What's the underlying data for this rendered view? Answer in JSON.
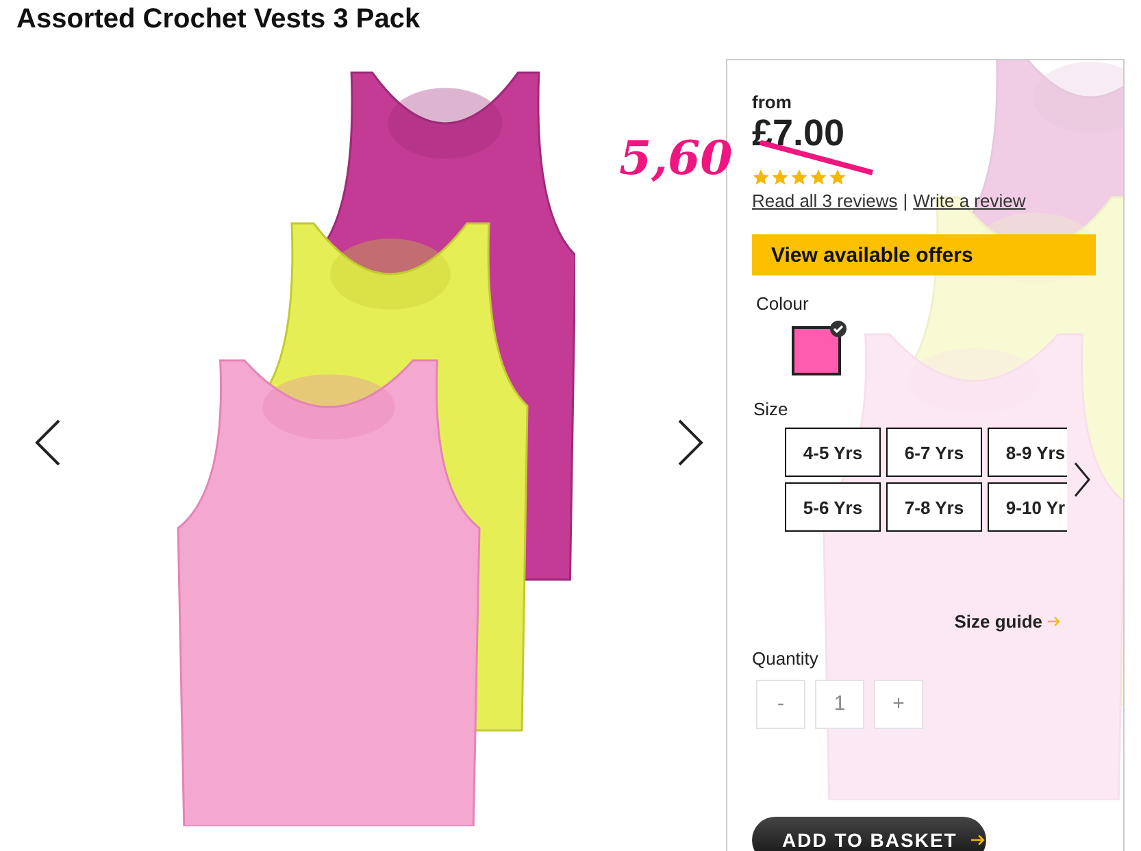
{
  "title": "Assorted Crochet Vests 3 Pack",
  "price": {
    "from": "from",
    "amount": "£7.00",
    "struck": true,
    "sale_note": "5,60"
  },
  "rating": {
    "stars": 5
  },
  "reviews": {
    "read": "Read all 3 reviews",
    "separator": "|",
    "write": "Write a review"
  },
  "offers_button": "View available offers",
  "colour": {
    "label": "Colour",
    "swatches": [
      {
        "color": "#ff5cb0",
        "selected": true
      }
    ]
  },
  "size": {
    "label": "Size",
    "options": [
      {
        "label": "4-5 Yrs",
        "selected": false
      },
      {
        "label": "6-7 Yrs",
        "selected": false
      },
      {
        "label": "8-9 Yrs",
        "selected": false
      },
      {
        "label": "5-6 Yrs",
        "selected": false
      },
      {
        "label": "7-8 Yrs",
        "selected": false
      },
      {
        "label": "9-10 Yr",
        "selected": false
      }
    ]
  },
  "size_guide": "Size guide",
  "quantity": {
    "label": "Quantity",
    "minus": "-",
    "value": "1",
    "plus": "+",
    "disabled": true
  },
  "add_to_basket": "ADD TO BASKET"
}
